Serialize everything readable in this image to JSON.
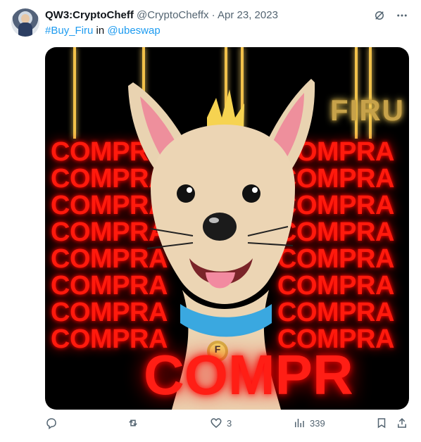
{
  "tweet": {
    "author": {
      "display_name": "QW3:CryptoCheff",
      "handle": "@CryptoCheffx",
      "separator": "·",
      "date": "Apr 23, 2023"
    },
    "hashtag": "#Buy_Firu",
    "in_word": "in",
    "community": "@ubeswap",
    "media": {
      "repeated_word": "COMPRA",
      "big_word": "COMPR",
      "gold_word": "FIRU",
      "collar_letter": "F"
    },
    "actions": {
      "likes": "3",
      "views": "339"
    }
  },
  "colors": {
    "accent": "#1d9bf0",
    "muted": "#536471",
    "red": "#ff1a0d",
    "gold": "#c7a24a"
  },
  "icons": {
    "top_right": [
      "grok-icon",
      "more-icon"
    ],
    "action_bar": [
      "reply-icon",
      "retweet-icon",
      "like-icon",
      "views-icon",
      "bookmark-icon",
      "share-icon"
    ]
  }
}
